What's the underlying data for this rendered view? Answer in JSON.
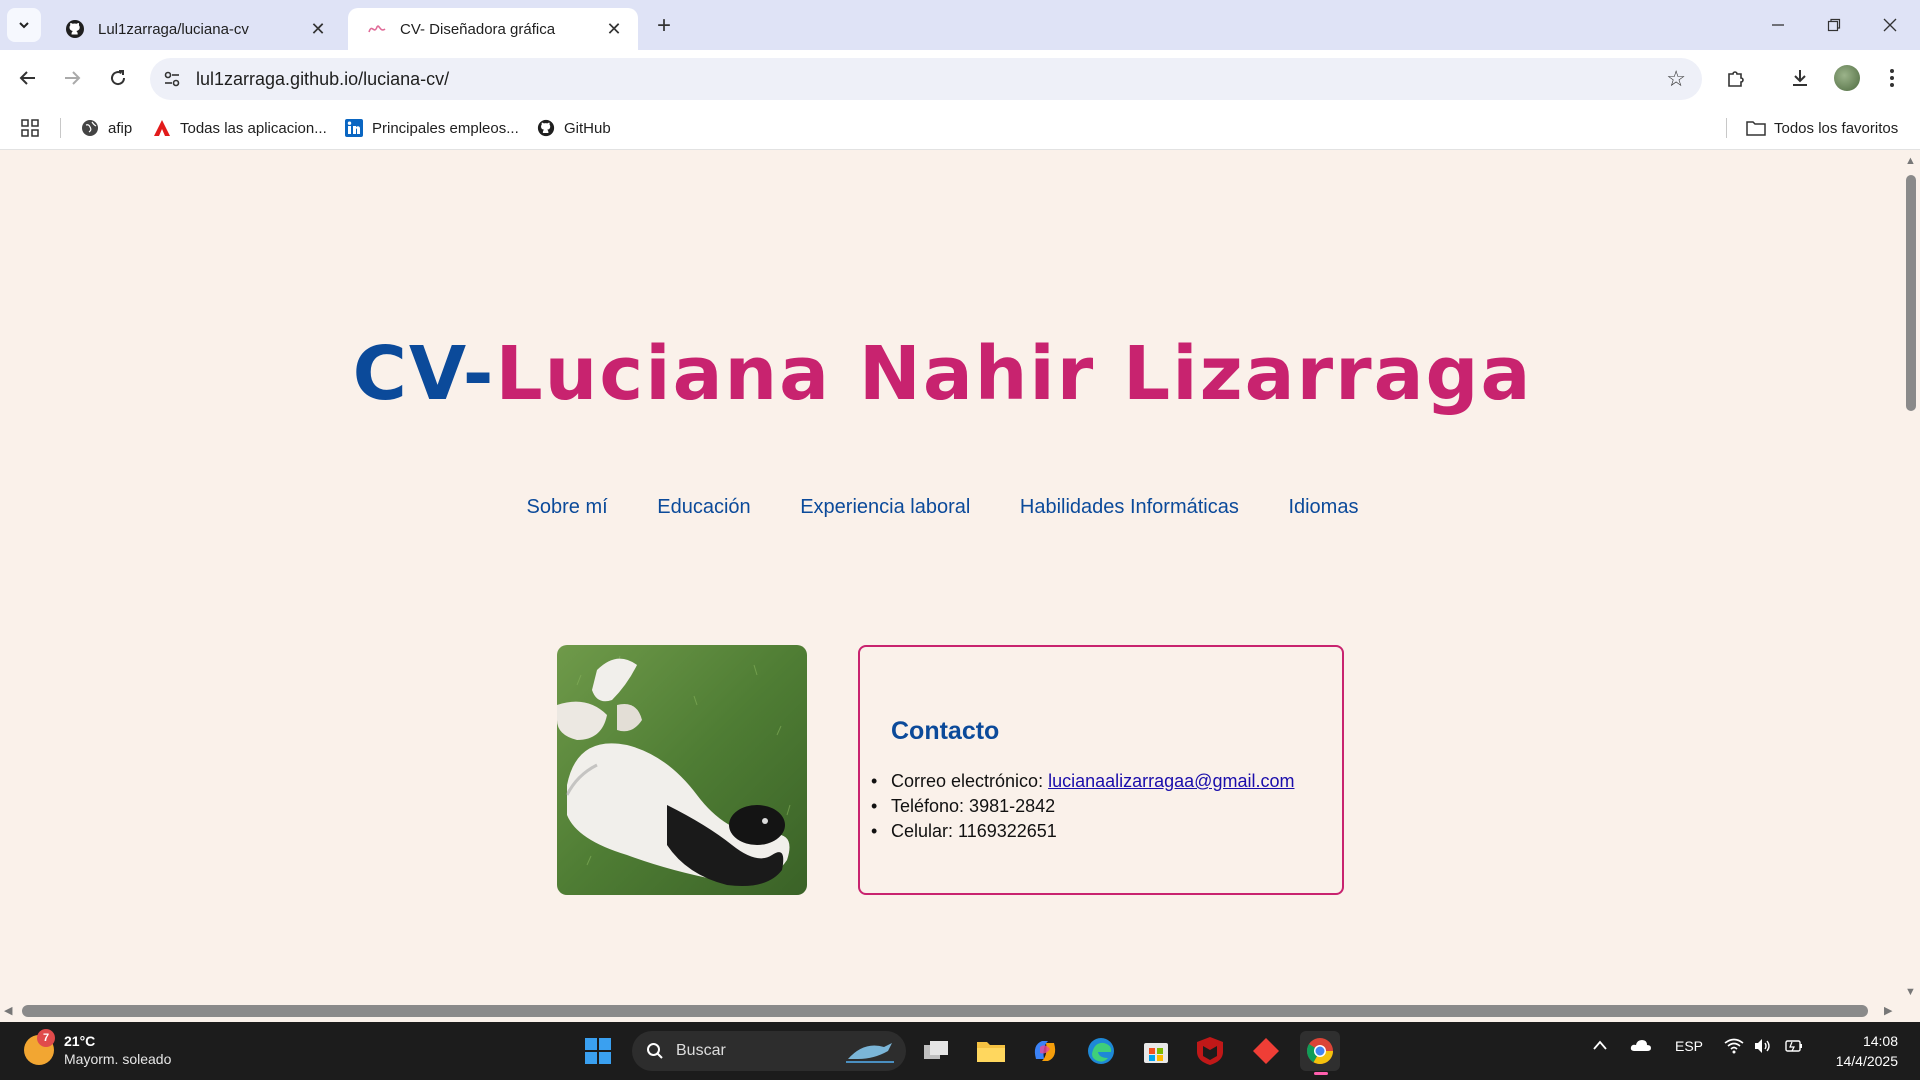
{
  "browser": {
    "tabs": [
      {
        "title": "Lul1zarraga/luciana-cv",
        "favicon": "github-icon",
        "active": false
      },
      {
        "title": "CV- Diseñadora gráfica",
        "favicon": "pink-signature-icon",
        "active": true
      }
    ],
    "url": "lul1zarraga.github.io/luciana-cv/",
    "bookmarks": [
      {
        "label": "afip",
        "icon": "globe-icon"
      },
      {
        "label": "Todas las aplicacion...",
        "icon": "adobe-icon"
      },
      {
        "label": "Principales empleos...",
        "icon": "linkedin-icon"
      },
      {
        "label": "GitHub",
        "icon": "github-icon"
      }
    ],
    "all_bookmarks_label": "Todos los favoritos"
  },
  "page": {
    "title_prefix": "CV-",
    "title_name": "Luciana Nahir Lizarraga",
    "nav": [
      "Sobre mí",
      "Educación",
      "Experiencia laboral",
      "Habilidades Informáticas",
      "Idiomas"
    ],
    "photo_alt": "dog-photo",
    "contact": {
      "heading": "Contacto",
      "email_label": "Correo electrónico: ",
      "email": "lucianaalizarragaa@gmail.com",
      "phone": "Teléfono: 3981-2842",
      "mobile": "Celular: 1169322651"
    }
  },
  "taskbar": {
    "weather_temp": "21°C",
    "weather_desc": "Mayorm. soleado",
    "weather_badge": "7",
    "search_placeholder": "Buscar",
    "lang": "ESP",
    "time": "14:08",
    "date": "14/4/2025"
  },
  "colors": {
    "accent_blue": "#0b4a9a",
    "accent_pink": "#c8236f",
    "page_bg": "#faf1ea"
  }
}
